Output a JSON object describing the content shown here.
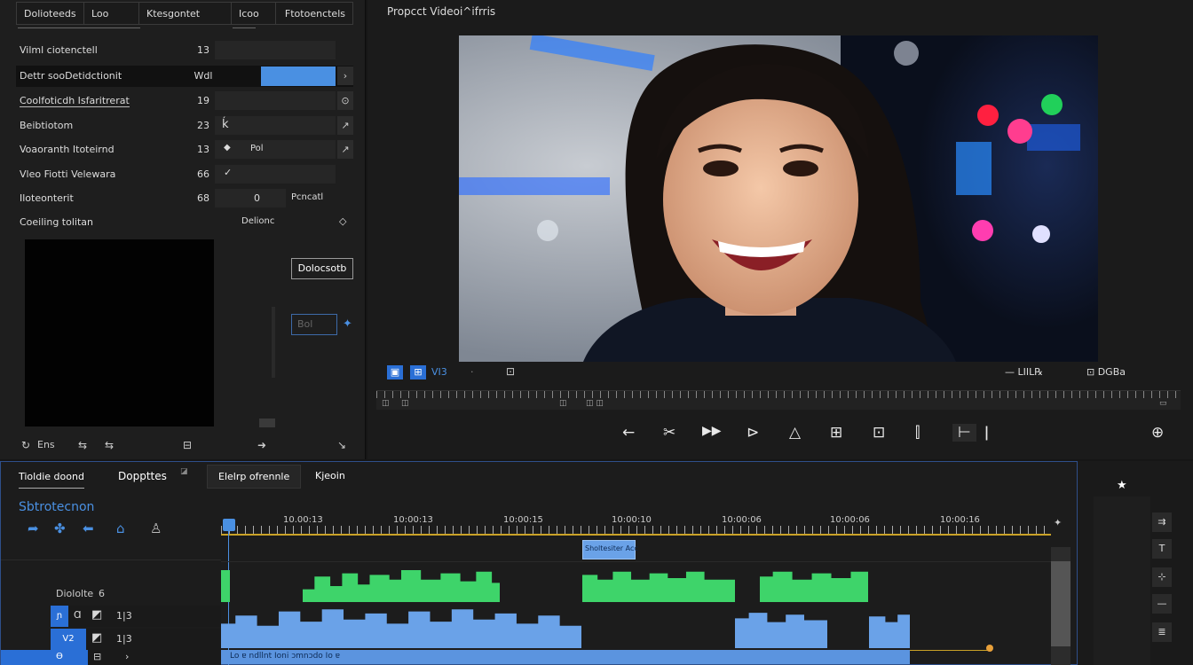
{
  "left_panel": {
    "tabs": [
      "Dolioteeds",
      "Loo",
      "Ktesgontet",
      "Icoo",
      "Ftotoenctels"
    ],
    "rows": [
      {
        "label": "Vilml ciotenctell",
        "num": "13",
        "btn": ""
      },
      {
        "label": "Dettr sooDetidctionit",
        "num": "Wdl",
        "btn": "›"
      },
      {
        "label": "Coolfoticdh Isfaritrerat",
        "num": "1​9",
        "btn": "⊙"
      },
      {
        "label": "Beibtiotom",
        "num": "23",
        "btn": "↗"
      },
      {
        "label": "Voaoranth Itoteirnd",
        "num": "13",
        "btn": "↗"
      },
      {
        "label": "Vleo Fiotti Velewara",
        "num": "66",
        "btn": ""
      },
      {
        "label": "Iloteonterit",
        "num": "68",
        "btn": ""
      },
      {
        "label": "Coeiling tolitan",
        "num": "",
        "btn": "◇"
      }
    ],
    "row_extras": {
      "r3_fld": "ḱ",
      "r4_fld": "Pol",
      "r6_val": "0",
      "r6_right": "Pcncatl",
      "r7_val": "Delionc"
    },
    "right_button": "Dolocsotb",
    "right_input": "Bol",
    "footer": [
      "Ens",
      "⇆",
      "⇆",
      "⊟",
      "➜",
      "↘"
    ]
  },
  "viewer": {
    "title": "Propcct Videoi^ifrris",
    "controls_left": [
      "▣",
      "⊞",
      "VI3",
      "·",
      "⊡"
    ],
    "controls_right": "— LIIL℞",
    "controls_right2": "⊡ DGBa",
    "transport": [
      "←",
      "✂",
      "▶▶",
      "⊳",
      "△",
      "⊞",
      "⊡",
      "⫿",
      "⊢",
      "ǀ",
      "⊕"
    ]
  },
  "timeline": {
    "tabs": [
      "Tioldie doond",
      "Doppttes",
      "Elelrp ofrennle",
      "Kjeoin"
    ],
    "section_title": "Sbtrotecnon",
    "ruler_labels": [
      "10.00:13",
      "10:00:13",
      "10:00:15",
      "10:00:10",
      "10:00:06",
      "10:00:06",
      "10:00:16"
    ],
    "clip_label": "Sholtesiter Acc",
    "track_label": "Diololte",
    "tracks": [
      {
        "name": "V1",
        "num": "1|3"
      },
      {
        "name": "V2",
        "num": "1|3"
      },
      {
        "name": "A1",
        "num": ""
      }
    ],
    "audio_strip_text": "Lo ɐ ndllnt Ioni ɔmnɔdo Io ɐ"
  },
  "right_tools": {
    "star": "★",
    "buttons": [
      "⇉",
      "T",
      "⊹",
      "—",
      "≣"
    ]
  }
}
